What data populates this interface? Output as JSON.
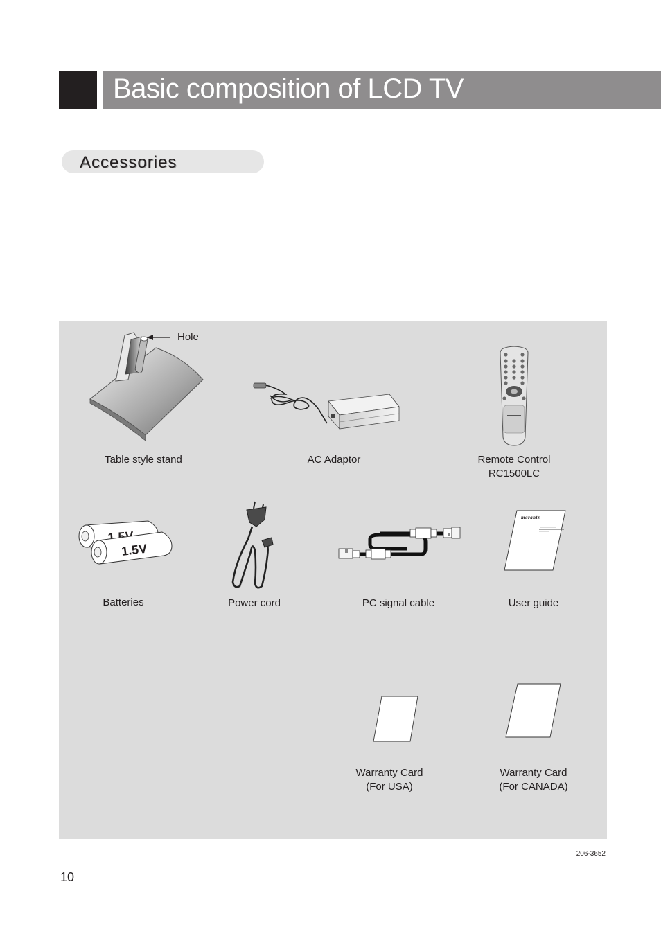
{
  "header": {
    "title": "Basic composition of LCD TV"
  },
  "section": {
    "title": "Accessories"
  },
  "accessories": {
    "table_stand": {
      "label": "Table style stand",
      "callout": "Hole"
    },
    "ac_adaptor": {
      "label": "AC Adaptor"
    },
    "remote_control": {
      "label_line1": "Remote Control",
      "label_line2": "RC1500LC"
    },
    "batteries": {
      "label": "Batteries",
      "voltage": "1.5V"
    },
    "power_cord": {
      "label": "Power cord"
    },
    "pc_signal_cable": {
      "label": "PC signal cable"
    },
    "user_guide": {
      "label": "User guide",
      "brand": "marantz"
    },
    "warranty_usa": {
      "label_line1": "Warranty Card",
      "label_line2": "(For USA)"
    },
    "warranty_canada": {
      "label_line1": "Warranty Card",
      "label_line2": "(For CANADA)"
    }
  },
  "footer": {
    "doc_code": "206-3652",
    "page_number": "10"
  }
}
